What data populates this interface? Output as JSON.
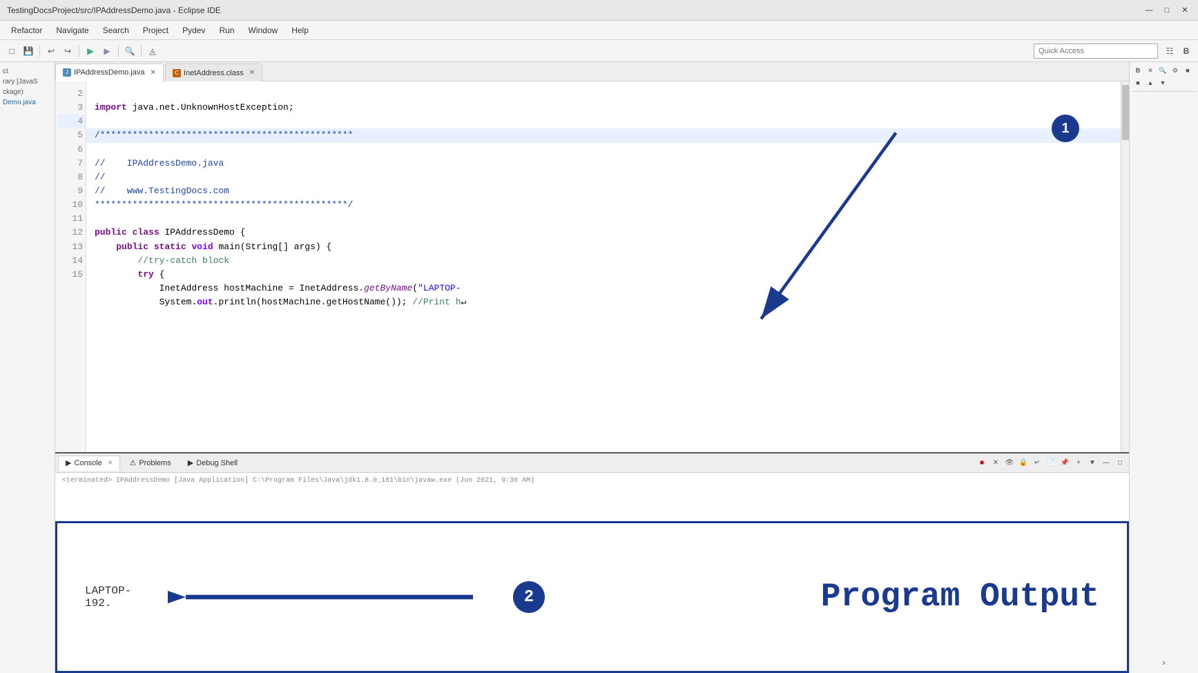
{
  "titleBar": {
    "title": "TestingDocsProject/src/IPAddressDemo.java - Eclipse IDE"
  },
  "menuBar": {
    "items": [
      "Refactor",
      "Navigate",
      "Search",
      "Project",
      "Pydev",
      "Run",
      "Window",
      "Help"
    ]
  },
  "toolbar": {
    "quickAccessPlaceholder": "Quick Access"
  },
  "tabs": [
    {
      "label": "IPAddressDemo.java",
      "active": true,
      "icon": "J"
    },
    {
      "label": "InetAddress.class",
      "active": false,
      "icon": "C"
    }
  ],
  "code": {
    "lines": [
      {
        "num": 2,
        "content": "import java.net.UnknownHostException;",
        "highlight": false
      },
      {
        "num": 3,
        "content": "",
        "highlight": false
      },
      {
        "num": 4,
        "content": "/***********************************************",
        "highlight": true
      },
      {
        "num": 5,
        "content": "//    IPAddressDemo.java",
        "highlight": false
      },
      {
        "num": 6,
        "content": "//",
        "highlight": false
      },
      {
        "num": 7,
        "content": "//    www.TestingDocs.com",
        "highlight": false
      },
      {
        "num": 8,
        "content": "***********************************************/",
        "highlight": false
      },
      {
        "num": 9,
        "content": "",
        "highlight": false
      },
      {
        "num": 10,
        "content": "public class IPAddressDemo {",
        "highlight": false
      },
      {
        "num": 11,
        "content": "    public static void main(String[] args) {",
        "highlight": false
      },
      {
        "num": 12,
        "content": "        //try-catch block",
        "highlight": false
      },
      {
        "num": 13,
        "content": "        try {",
        "highlight": false
      },
      {
        "num": 14,
        "content": "            InetAddress hostMachine = InetAddress.getByName(\"LAPTOP-",
        "highlight": false
      },
      {
        "num": 15,
        "content": "            System.out.println(hostMachine.getHostName()); //Print h",
        "highlight": false
      }
    ]
  },
  "sidebar": {
    "labels": [
      "ct",
      "rary [JavaS",
      "ckage)",
      "Demo.java"
    ]
  },
  "bottomPanel": {
    "tabs": [
      "Console",
      "Problems",
      "Debug Shell"
    ],
    "activeTab": "Console",
    "consoleOutput": [
      "LAPTOP-",
      "192."
    ]
  },
  "annotations": {
    "badge1": "1",
    "badge2": "2",
    "programOutputLabel": "Program Output"
  }
}
